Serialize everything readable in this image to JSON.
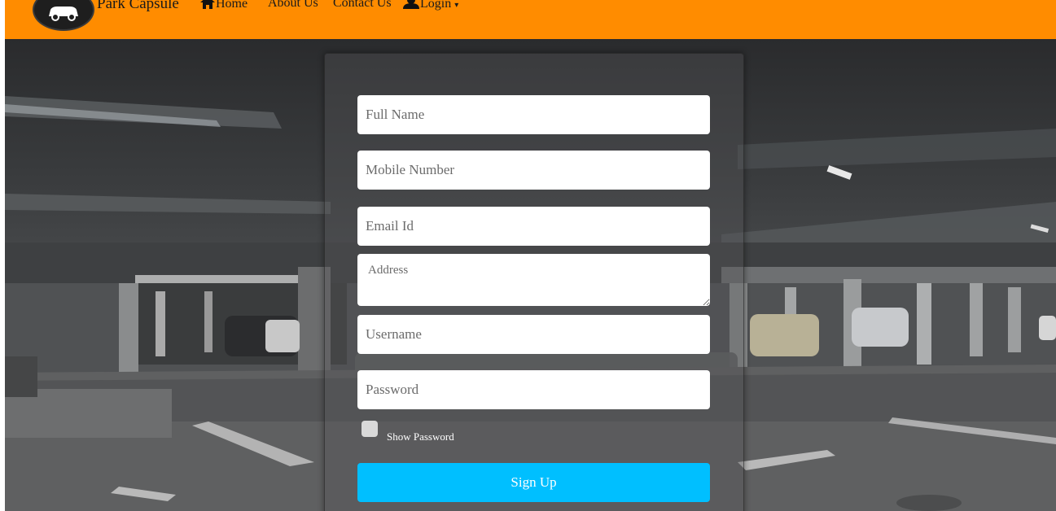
{
  "nav": {
    "brand": "Park Capsule",
    "home": "Home",
    "about": "About Us",
    "contact": "Contact Us",
    "login": "Login"
  },
  "form": {
    "full_name_placeholder": "Full Name",
    "mobile_placeholder": "Mobile Number",
    "email_placeholder": "Email Id",
    "address_placeholder": "Address",
    "username_placeholder": "Username",
    "password_placeholder": "Password",
    "show_password_label": "Show Password",
    "signup_label": "Sign Up"
  },
  "icons": {
    "logo": "car-icon",
    "home": "home-icon",
    "login": "user-icon"
  },
  "colors": {
    "navbar": "#ff8c00",
    "signup_button": "#00bfff"
  }
}
